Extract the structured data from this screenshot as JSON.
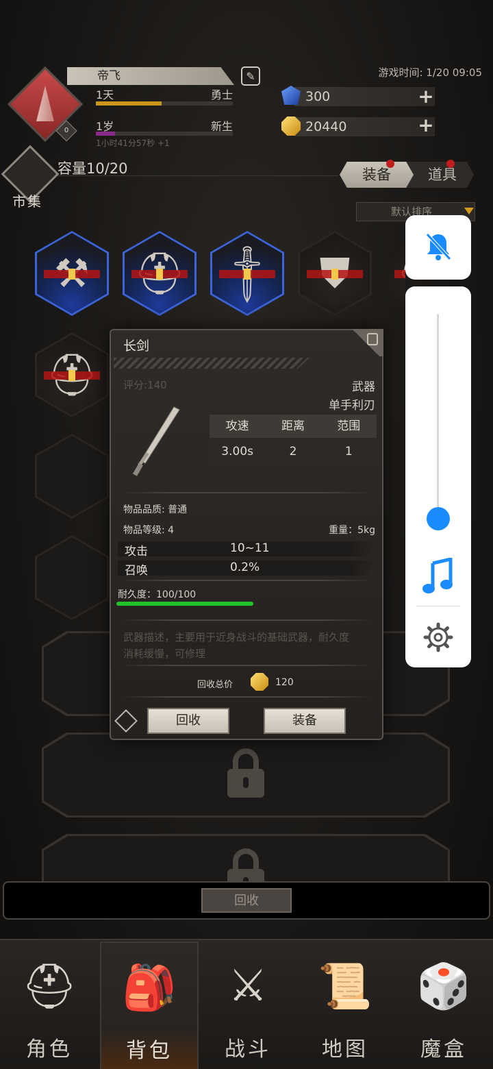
{
  "header": {
    "player_name": "帝飞",
    "class_value": "1天",
    "class_tag": "勇士",
    "age_value": "1岁",
    "age_tag": "新生",
    "timer_text": "1小时41分57秒 +1",
    "game_time": "游戏时间: 1/20 09:05",
    "avatar_level": "0",
    "exp_fill_color": "#c9961e",
    "age_fill_color": "#8a2a8a"
  },
  "currency": {
    "gems": "300",
    "gold": "20440"
  },
  "market": {
    "label": "市集",
    "capacity": "容量10/20"
  },
  "tabs": {
    "equip": "装备",
    "items": "道具",
    "sort": "默认排序"
  },
  "inventory": {
    "items": [
      {
        "name": "hammer",
        "icon": "hammer-icon",
        "style": "blue"
      },
      {
        "name": "helmet",
        "icon": "helmet-icon",
        "style": "blue"
      },
      {
        "name": "sword",
        "icon": "sword-icon",
        "style": "blue"
      },
      {
        "name": "chest-armor",
        "icon": "armor-icon",
        "style": "dark"
      },
      {
        "name": "helmet-2",
        "icon": "helmet-icon",
        "style": "dark"
      },
      {
        "name": "helmet-3",
        "icon": "helmet-icon",
        "style": "dark"
      }
    ]
  },
  "recycle_bar": {
    "button": "回收"
  },
  "nav": [
    {
      "label": "角色",
      "icon": "viking-helmet-icon"
    },
    {
      "label": "背包",
      "icon": "backpack-icon"
    },
    {
      "label": "战斗",
      "icon": "shield-sword-icon"
    },
    {
      "label": "地图",
      "icon": "scroll-icon"
    },
    {
      "label": "魔盒",
      "icon": "magic-box-icon"
    }
  ],
  "item_detail": {
    "title": "长剑",
    "score": "评分:140",
    "type": "武器",
    "subtype": "单手利刃",
    "stats_headers": [
      "攻速",
      "距离",
      "范围"
    ],
    "stats_values": [
      "3.00s",
      "2",
      "1"
    ],
    "quality": "物品品质: 普通",
    "level": "物品等级: 4",
    "weight": "重量：5kg",
    "attributes": [
      {
        "name": "攻击",
        "value": "10~11"
      },
      {
        "name": "召唤",
        "value": "0.2%"
      }
    ],
    "durability": "耐久度：100/100",
    "durability_fraction": 1.0,
    "description": "武器描述，主要用于近身战斗的基础武器，耐久度消耗缓慢，可修理",
    "recycle_total_label": "回收总价",
    "recycle_total_value": "120",
    "buttons": {
      "recycle": "回收",
      "equip": "装备"
    }
  },
  "volume_panel": {
    "level_fraction": 0.02,
    "accent": "#1a8cff"
  }
}
